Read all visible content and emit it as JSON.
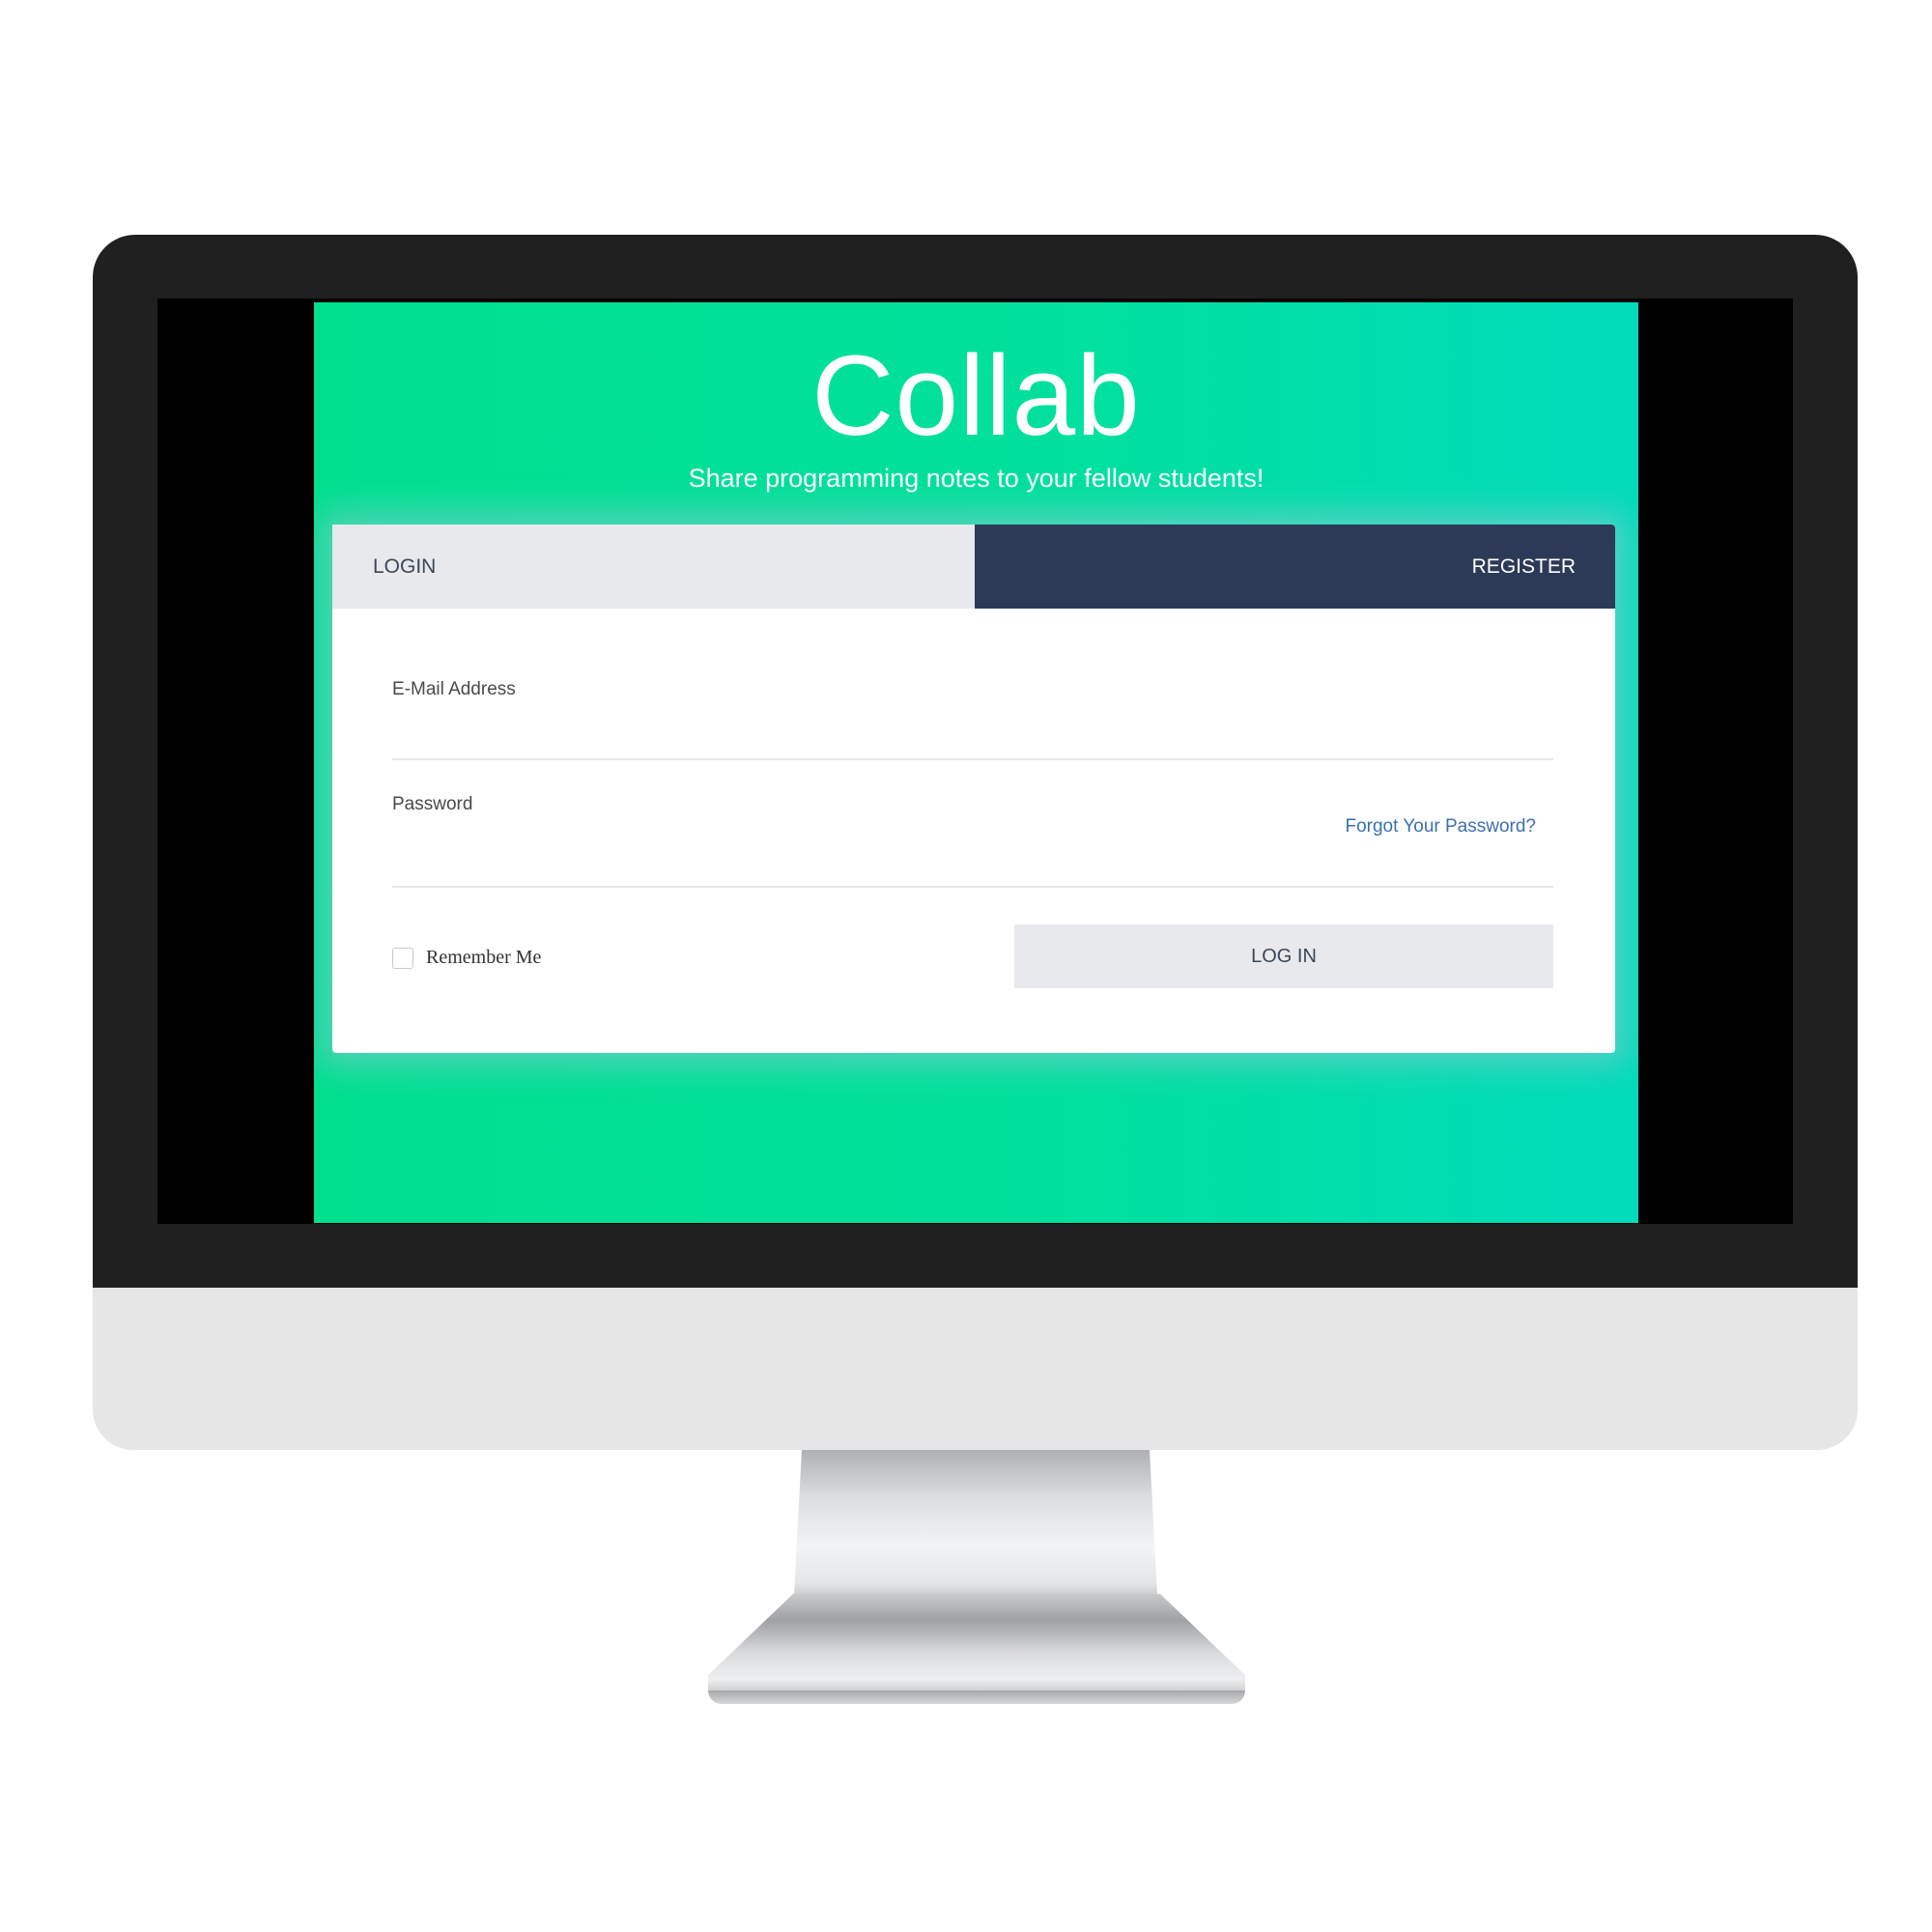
{
  "app": {
    "title": "Collab",
    "subtitle": "Share programming notes to your fellow students!"
  },
  "tabs": {
    "login_label": "LOGIN",
    "register_label": "REGISTER"
  },
  "form": {
    "email_label": "E-Mail Address",
    "email_value": "",
    "password_label": "Password",
    "password_value": "",
    "forgot_password_label": "Forgot Your Password?",
    "remember_me_label": "Remember Me",
    "remember_me_checked": false,
    "login_button_label": "LOG IN"
  },
  "colors": {
    "gradient_start": "#00df8e",
    "gradient_end": "#00dbbb",
    "register_tab": "#2c3a57",
    "tab_inactive": "#e8e9ec",
    "link": "#3d6fb0"
  }
}
